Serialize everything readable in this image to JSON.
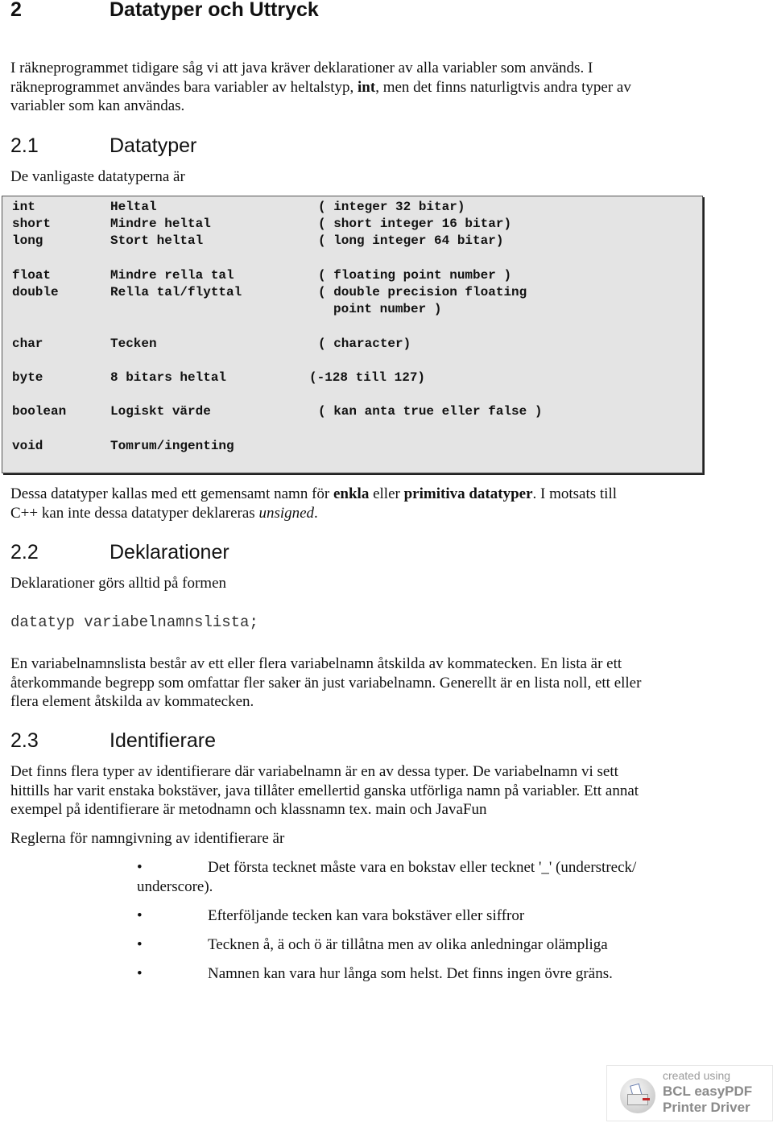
{
  "chapter": {
    "number": "2",
    "title": "Datatyper och Uttryck"
  },
  "intro": {
    "lines": [
      [
        "I räkneprogrammet tidigare såg vi att java kräver deklarationer av alla variabler som används. I"
      ],
      [
        "räkneprogrammet användes bara  variabler av heltalstyp, ",
        "int",
        ", men det finns naturligtvis andra typer av"
      ],
      [
        "variabler som kan användas."
      ]
    ],
    "line1": "I räkneprogrammet tidigare såg vi att java kräver deklarationer av alla variabler som används. I",
    "line2_pre": "räkneprogrammet användes bara  variabler av heltalstyp, ",
    "line2_bold": "int",
    "line2_post": ", men det finns naturligtvis andra typer av",
    "line3": "variabler som kan användas."
  },
  "section_2_1": {
    "number": "2.1",
    "title": "Datatyper",
    "lead": "De vanligaste datatyperna är",
    "types": [
      {
        "type": "int",
        "swedish": "Heltal",
        "desc": "( integer 32 bitar)"
      },
      {
        "type": "short",
        "swedish": "Mindre heltal",
        "desc": "( short integer 16 bitar)"
      },
      {
        "type": "long",
        "swedish": "Stort heltal",
        "desc": "( long integer 64 bitar)"
      },
      {
        "type": "float",
        "swedish": "Mindre rella tal",
        "desc": "( floating point number )"
      },
      {
        "type": "double",
        "swedish": "Rella tal/flyttal",
        "desc": "( double precision floating",
        "desc2": "point number )"
      },
      {
        "type": "char",
        "swedish": "Tecken",
        "desc": "( character)"
      },
      {
        "type": "byte",
        "swedish": "8 bitars heltal",
        "desc": "(-128 till 127)"
      },
      {
        "type": "boolean",
        "swedish": "Logiskt värde",
        "desc": "( kan anta true eller false )"
      },
      {
        "type": "void",
        "swedish": "Tomrum/ingenting",
        "desc": ""
      }
    ],
    "after_l1_a": "Dessa datatyper kallas med ett gemensamt namn för ",
    "after_l1_b": "enkla",
    "after_l1_c": " eller ",
    "after_l1_d": "primitiva datatyper",
    "after_l1_e": ". I motsats till",
    "after_l2_a": "C++ kan inte dessa datatyper deklareras ",
    "after_l2_b": "unsigned",
    "after_l2_c": "."
  },
  "section_2_2": {
    "number": "2.2",
    "title": "Deklarationer",
    "lead": "Deklarationer görs alltid på formen",
    "syntax": "datatyp variabelnamnslista;",
    "p1": "En variabelnamnslista består av ett eller flera variabelnamn åtskilda av kommatecken. En lista är ett",
    "p2": "återkommande begrepp som omfattar fler saker än just variabelnamn. Generellt är en lista noll, ett eller",
    "p3": "flera element åtskilda av kommatecken."
  },
  "section_2_3": {
    "number": "2.3",
    "title": "Identifierare",
    "p1": "Det finns flera typer av identifierare där variabelnamn är en av dessa typer. De variabelnamn vi sett",
    "p2": "hittills har varit enstaka bokstäver, java tillåter emellertid ganska utförliga namn på variabler. Ett annat",
    "p3": "exempel på identifierare är metodnamn och klassnamn tex. main och JavaFun",
    "rules_lead": "Reglerna för namngivning av identifierare är",
    "bullet_glyph": "•",
    "rules": [
      "Det första tecknet måste vara en bokstav eller tecknet '_' (understreck/",
      "Efterföljande tecken kan vara bokstäver eller siffror",
      "Tecknen å, ä och ö är tillåtna men av olika anledningar olämpliga",
      "Namnen kan vara hur långa som helst. Det finns ingen övre gräns."
    ],
    "rule1_cont": "underscore)."
  },
  "watermark": {
    "icon": "printer-icon",
    "line1": "created using",
    "line2": "BCL easyPDF",
    "line3": "Printer Driver"
  }
}
